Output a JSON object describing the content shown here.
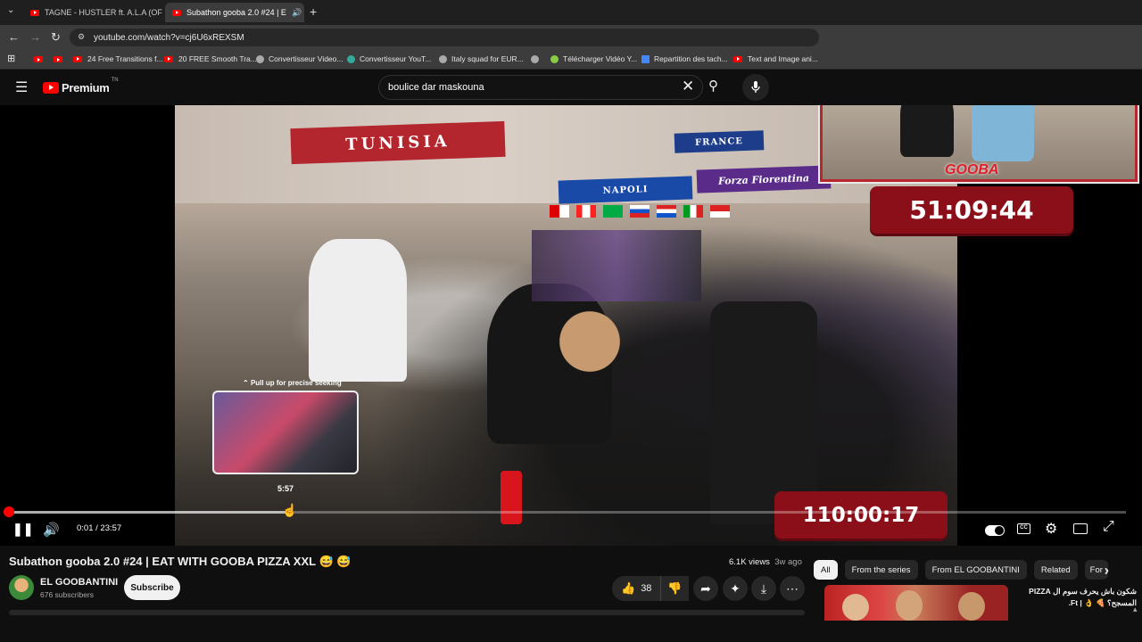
{
  "browser": {
    "tabs": [
      {
        "title": "TAGNE - HUSTLER ft. A.L.A (OFF",
        "active": false
      },
      {
        "title": "Subathon gooba 2.0 #24 | E",
        "active": true
      }
    ],
    "new_tab": "+",
    "url": "youtube.com/watch?v=cj6U6xREXSM",
    "bookmarks": [
      "24 Free Transitions f...",
      "20 FREE Smooth Tra...",
      "Convertisseur Video...",
      "Convertisseur YouT...",
      "Italy squad for EUR...",
      "Télécharger Vidéo Y...",
      "Repartition des tach...",
      "Text and Image ani..."
    ]
  },
  "youtube": {
    "logo_text": "Premium",
    "logo_sup": "TN",
    "search_value": "boulice dar maskouna"
  },
  "player": {
    "banner_tunisia": "TUNISIA",
    "banner_napoli": "NAPOLI",
    "banner_fiorentina": "Forza Fiorentina",
    "banner_france": "FRANCE",
    "overlay_logo": "GOOBA",
    "timer_top": "51:09:44",
    "timer_bottom": "110:00:17",
    "seek_hint": "Pull up for precise seeking",
    "preview_time": "5:57",
    "current_time": "0:01",
    "separator": "/",
    "duration": "23:57",
    "progress_fraction": 0.0007
  },
  "video": {
    "title": "Subathon gooba 2.0 #24 | EAT WITH GOOBA PIZZA XXL",
    "title_emoji": "😅 😅",
    "views": "6.1K views",
    "age": "3w ago",
    "channel_name": "EL GOOBANTINI",
    "subscribers": "676 subscribers",
    "subscribe_label": "Subscribe",
    "likes": "38"
  },
  "sidebar": {
    "chips": [
      "All",
      "From the series",
      "From EL GOOBANTINI",
      "Related",
      "For y"
    ],
    "rec_title_line1": "شكون باش يحرف سوم ال PIZZA",
    "rec_title_line2": "المسجح؟ 🍕 👌 | Ft."
  },
  "colors": {
    "accent_red": "#ff0000",
    "timer_red": "#8b0f18",
    "background": "#0f0f0f"
  }
}
